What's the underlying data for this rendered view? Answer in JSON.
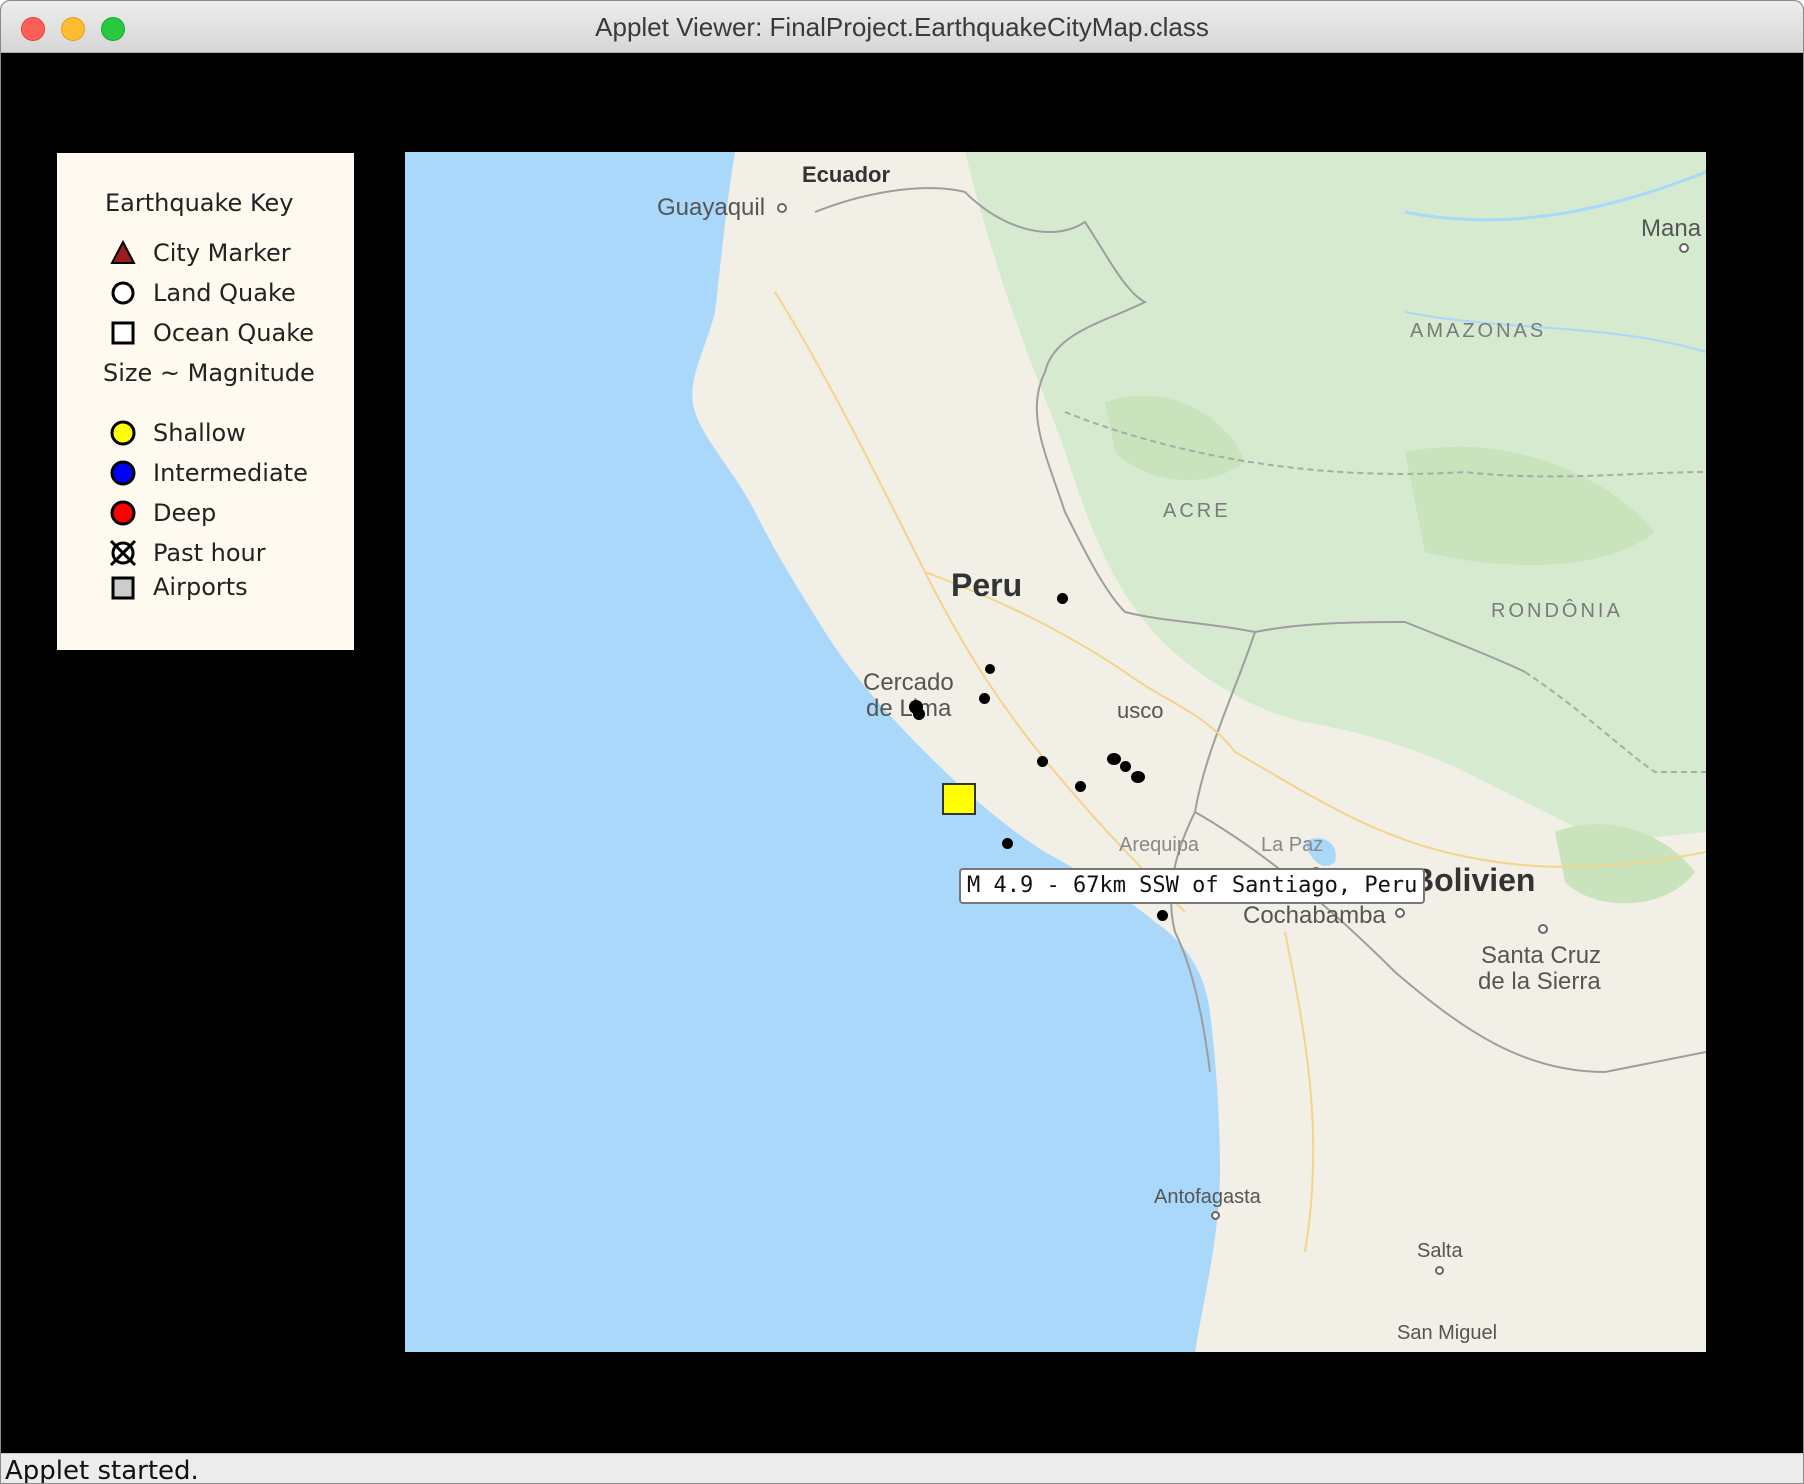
{
  "window": {
    "title": "Applet Viewer: FinalProject.EarthquakeCityMap.class"
  },
  "legend": {
    "title": "Earthquake Key",
    "items": [
      {
        "label": "City Marker",
        "icon": "triangle-icon",
        "color": "#9b1c1c"
      },
      {
        "label": "Land Quake",
        "icon": "circle-outline-icon",
        "color": "#ffffff"
      },
      {
        "label": "Ocean Quake",
        "icon": "square-outline-icon",
        "color": "#ffffff"
      }
    ],
    "size_label": "Size ~ Magnitude",
    "depth_items": [
      {
        "label": "Shallow",
        "icon": "circle-icon",
        "color": "#ffff00"
      },
      {
        "label": "Intermediate",
        "icon": "circle-icon",
        "color": "#0000ff"
      },
      {
        "label": "Deep",
        "icon": "circle-icon",
        "color": "#ff0000"
      },
      {
        "label": "Past hour",
        "icon": "crossed-circle-icon",
        "color": "#ffffff"
      },
      {
        "label": "Airports",
        "icon": "gray-square-icon",
        "color": "#cccccc"
      }
    ]
  },
  "map": {
    "labels": {
      "ecuador": "Ecuador",
      "guayaquil": "Guayaquil",
      "manaus": "Mana",
      "amazonas": "AMAZONAS",
      "acre": "ACRE",
      "rondonia": "RONDÔNIA",
      "peru": "Peru",
      "lima_1": "Cercado",
      "lima_2": "de Lima",
      "cusco": "usco",
      "bolivien": "Bolivien",
      "cochabamba": "Cochabamba",
      "santa_cruz_1": "Santa Cruz",
      "santa_cruz_2": "de la Sierra",
      "antofagasta": "Antofagasta",
      "salta": "Salta",
      "san_miguel": "San Miguel",
      "arequipa": "Arequipa",
      "la_paz": "La Paz"
    },
    "tooltip": "M 4.9 - 67km SSW of Santiago, Peru",
    "colors": {
      "ocean": "#a9d8fb",
      "land": "#f2efe6",
      "forest": "#cfe7c4",
      "shallow": "#ffff00"
    }
  },
  "status": {
    "text": "Applet started."
  }
}
